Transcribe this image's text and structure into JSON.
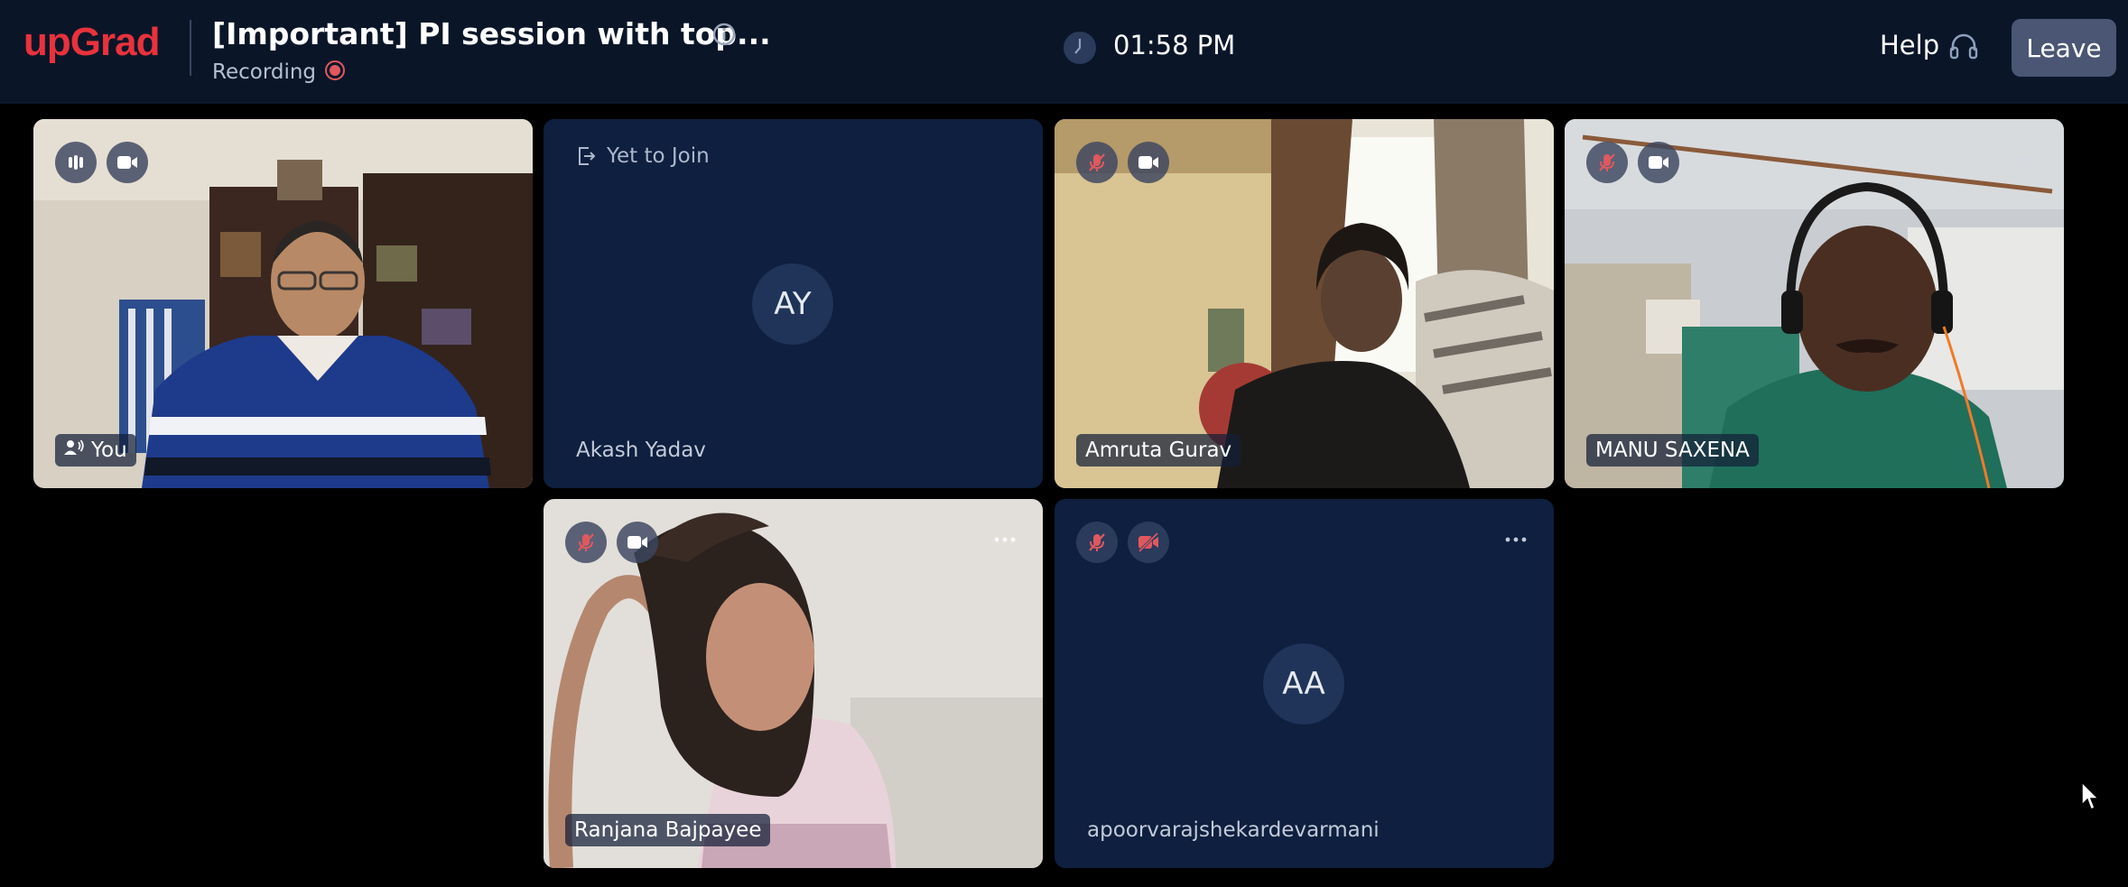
{
  "header": {
    "logo": "upGrad",
    "title": "[Important] PI session with top...",
    "recording_label": "Recording",
    "time": "01:58 PM",
    "help_label": "Help",
    "leave_label": "Leave"
  },
  "tiles": [
    {
      "name": "You",
      "icons": [
        "audio-level-icon",
        "camera-icon"
      ],
      "speaking": true
    },
    {
      "name": "Akash Yadav",
      "status": "Yet to Join",
      "initials": "AY"
    },
    {
      "name": "Amruta Gurav",
      "icons": [
        "mic-muted-icon",
        "camera-icon"
      ]
    },
    {
      "name": "MANU SAXENA",
      "icons": [
        "mic-muted-icon",
        "camera-icon"
      ],
      "has_more": true
    },
    {
      "name": "Ranjana Bajpayee",
      "icons": [
        "mic-muted-icon",
        "camera-icon"
      ],
      "has_more": true
    },
    {
      "name": "apoorvarajshekardevarmani",
      "initials": "AA",
      "icons": [
        "mic-muted-icon",
        "camera-off-icon"
      ],
      "has_more": true
    }
  ],
  "colors": {
    "brand": "#e8323c",
    "header_bg": "#0a1628",
    "tile_bg": "#0e1f3f",
    "leave_bg": "#4a5674",
    "muted_red": "#e0585f"
  }
}
